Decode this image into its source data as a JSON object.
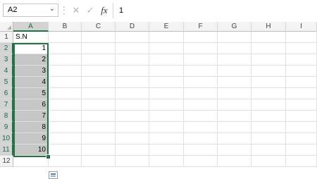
{
  "formula_bar": {
    "name_box": "A2",
    "cancel_icon": "✕",
    "enter_icon": "✓",
    "fx_label": "fx",
    "formula_value": "1"
  },
  "columns": [
    "A",
    "B",
    "C",
    "D",
    "E",
    "F",
    "G",
    "H",
    "I"
  ],
  "rows": [
    "1",
    "2",
    "3",
    "4",
    "5",
    "6",
    "7",
    "8",
    "9",
    "10",
    "11",
    "12"
  ],
  "cells": {
    "A1": "S.N",
    "A2": "1",
    "A3": "2",
    "A4": "3",
    "A5": "4",
    "A6": "5",
    "A7": "6",
    "A8": "7",
    "A9": "8",
    "A10": "9",
    "A11": "10"
  },
  "selection": {
    "range": "A2:A11",
    "active_cell": "A2"
  },
  "colors": {
    "accent": "#217346",
    "selection_fill": "#c6c6c6"
  }
}
